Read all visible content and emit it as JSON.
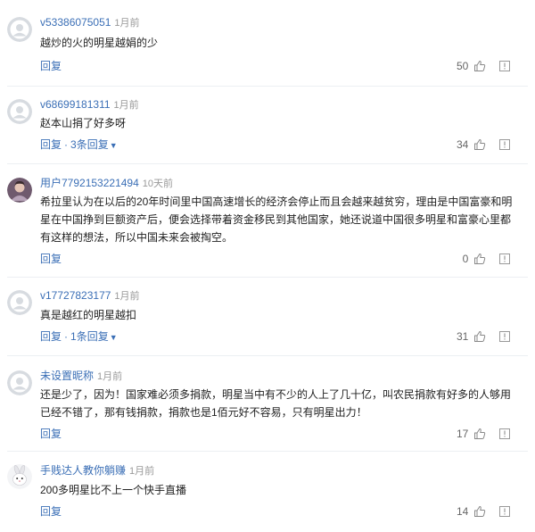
{
  "comments": [
    {
      "username": "v53386075051",
      "time": "1月前",
      "text": "越炒的火的明星越娟的少",
      "reply_label": "回复",
      "replies_label": "",
      "likes": "50",
      "avatar": "default-gray-avatar"
    },
    {
      "username": "v68699181311",
      "time": "1月前",
      "text": "赵本山捐了好多呀",
      "reply_label": "回复",
      "replies_label": "3条回复",
      "likes": "34",
      "avatar": "default-gray-avatar"
    },
    {
      "username": "用户7792153221494",
      "time": "10天前",
      "text": "希拉里认为在以后的20年时间里中国高速增长的经济会停止而且会越来越贫穷，理由是中国富豪和明星在中国挣到巨额资产后，便会选择带着资金移民到其他国家，她还说道中国很多明星和富豪心里都有这样的想法，所以中国未来会被掏空。",
      "reply_label": "回复",
      "replies_label": "",
      "likes": "0",
      "avatar": "portrait-avatar"
    },
    {
      "username": "v17727823177",
      "time": "1月前",
      "text": "真是越红的明星越扣",
      "reply_label": "回复",
      "replies_label": "1条回复",
      "likes": "31",
      "avatar": "default-gray-avatar"
    },
    {
      "username": "未设置昵称",
      "time": "1月前",
      "text": "还是少了，因为！国家难必须多捐款，明星当中有不少的人上了几十亿，叫农民捐款有好多的人够用已经不错了，那有钱捐款，捐款也是1佰元好不容易，只有明星出力！",
      "reply_label": "回复",
      "replies_label": "",
      "likes": "17",
      "avatar": "default-gray-avatar"
    },
    {
      "username": "手贱达人教你躺赚",
      "time": "1月前",
      "text": "200多明星比不上一个快手直播",
      "reply_label": "回复",
      "replies_label": "",
      "likes": "14",
      "avatar": "rabbit-avatar"
    }
  ],
  "colors": {
    "username": "#3b6fb6",
    "action": "#3b6fb6",
    "meta": "#999999",
    "divider": "#eceff3"
  },
  "icons": {
    "like": "thumbs-up-icon",
    "report": "report-icon",
    "expand": "chevron-down-icon"
  }
}
